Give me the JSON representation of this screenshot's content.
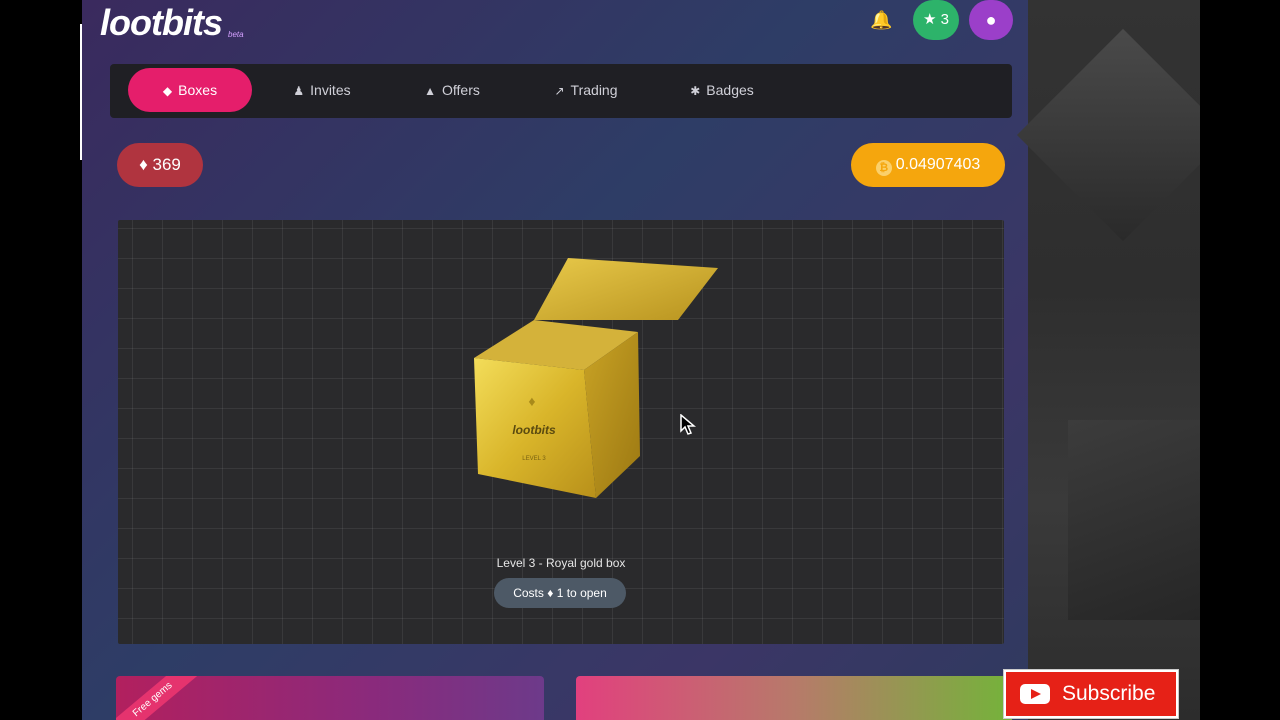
{
  "brand": {
    "logo": "lootbits",
    "beta": "beta"
  },
  "header": {
    "stars_count": "3"
  },
  "nav": {
    "items": [
      {
        "label": "Boxes",
        "icon": "box-icon",
        "active": true
      },
      {
        "label": "Invites",
        "icon": "users-icon",
        "active": false
      },
      {
        "label": "Offers",
        "icon": "fire-icon",
        "active": false
      },
      {
        "label": "Trading",
        "icon": "chart-icon",
        "active": false
      },
      {
        "label": "Badges",
        "icon": "badge-icon",
        "active": false
      }
    ]
  },
  "balances": {
    "gems": "369",
    "btc": "0.04907403"
  },
  "box": {
    "title": "Level 3 - Royal gold box",
    "cost_prefix": "Costs",
    "cost_value": "1 to open",
    "face_logo": "lootbits",
    "face_level": "LEVEL 3"
  },
  "promo": {
    "ribbon": "Free gems"
  },
  "youtube": {
    "subscribe_label": "Subscribe"
  },
  "colors": {
    "accent_pink": "#e51e6b",
    "btc_orange": "#f5a60d",
    "stars_green": "#2db36a",
    "user_purple": "#9b3fc9",
    "subscribe_red": "#e62117"
  }
}
